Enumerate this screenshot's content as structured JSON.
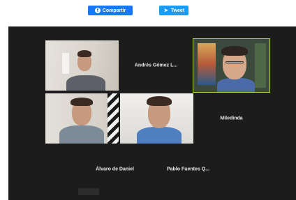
{
  "share": {
    "facebook_label": "Compartir",
    "facebook_icon": "facebook-icon",
    "twitter_label": "Tweet",
    "twitter_icon": "twitter-bird-icon"
  },
  "meeting": {
    "background_color": "#1c1c1c",
    "active_speaker_border_color": "#b6d43e",
    "participants": [
      {
        "name": "",
        "has_video": true
      },
      {
        "name": "Andrés Gómez L...",
        "has_video": false
      },
      {
        "name": "",
        "has_video": true,
        "active_speaker": true
      },
      {
        "name": "",
        "has_video": true
      },
      {
        "name": "",
        "has_video": true
      },
      {
        "name": "Miledinda",
        "has_video": false
      },
      {
        "name": "Álvaro de Daniel",
        "has_video": false
      },
      {
        "name": "Pablo Fuentes Q...",
        "has_video": false
      }
    ]
  }
}
